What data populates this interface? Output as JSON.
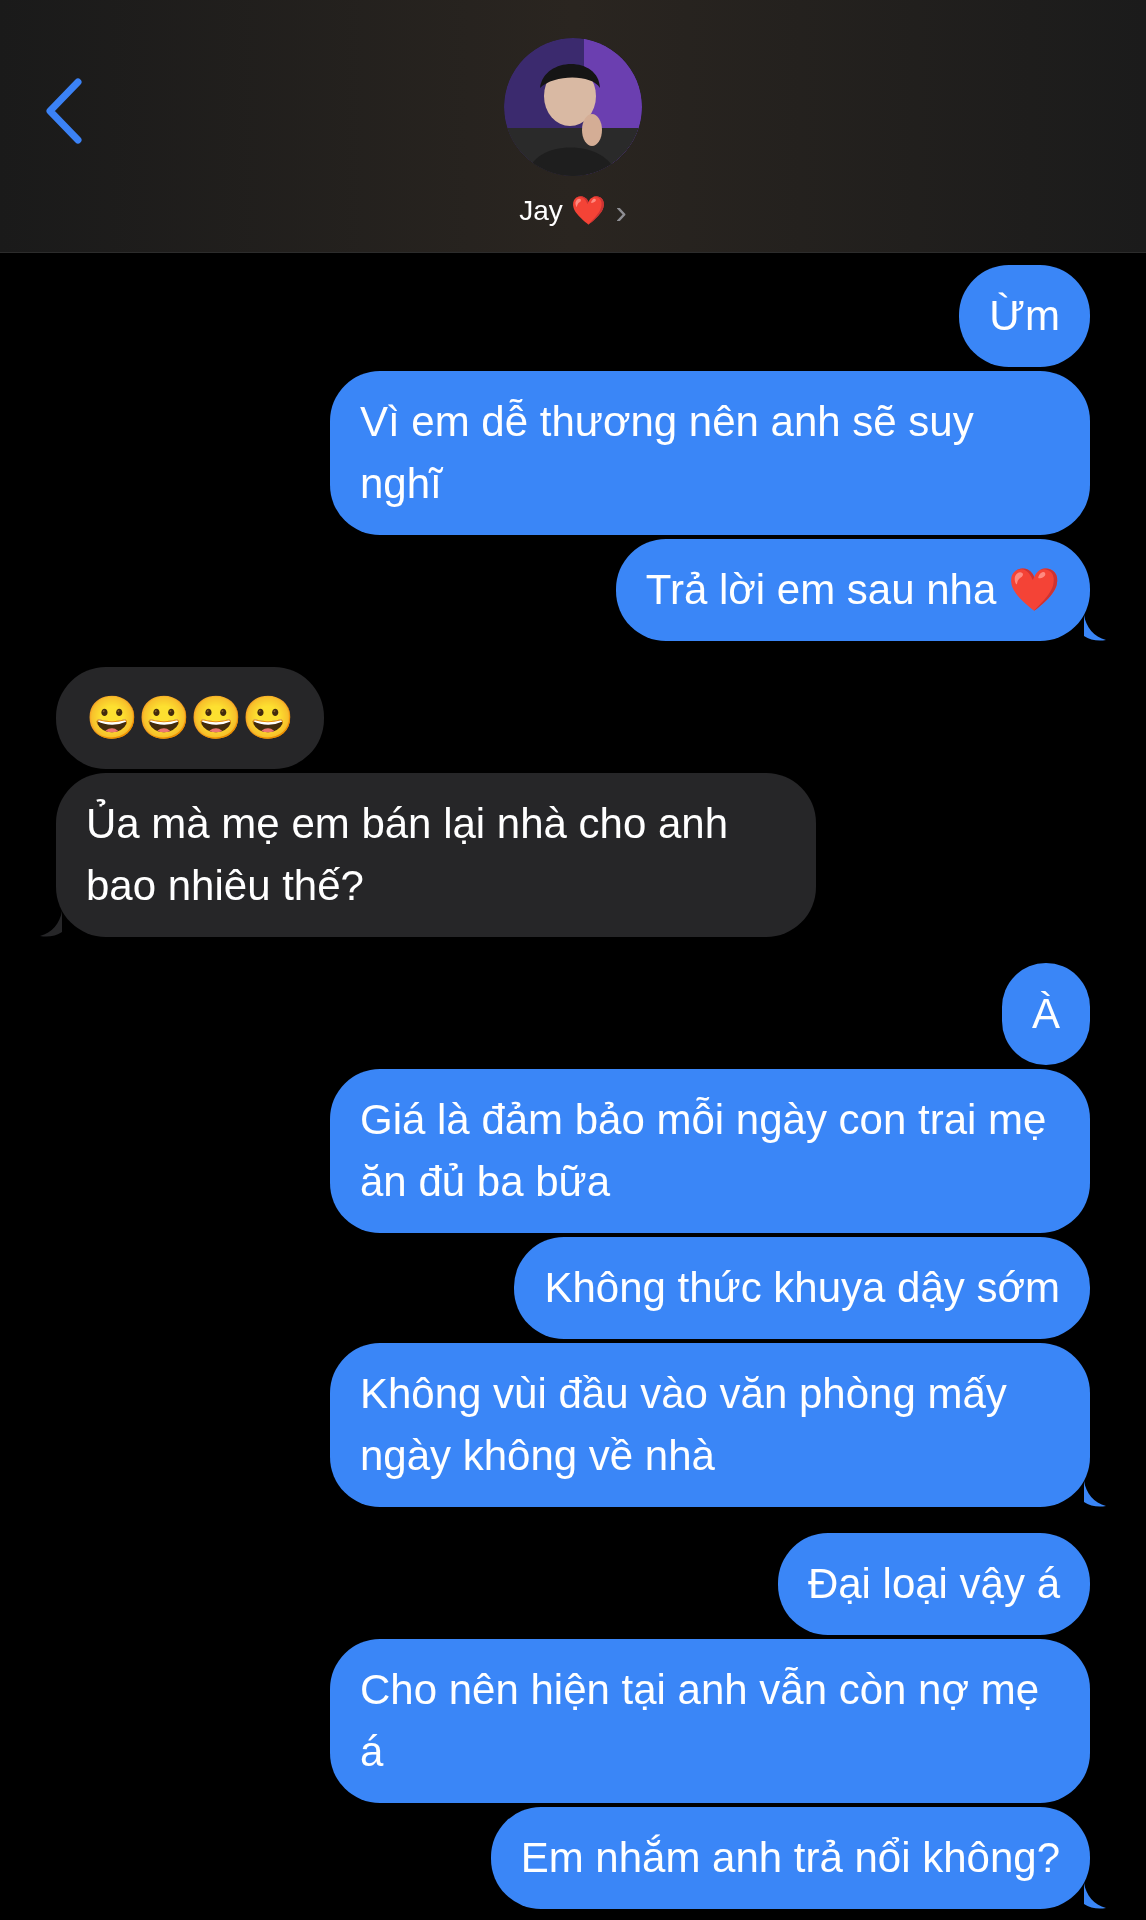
{
  "header": {
    "contact_name": "Jay ❤️",
    "chevron": "›"
  },
  "messages": [
    {
      "kind": "sent",
      "text": "Ừm",
      "tail": false
    },
    {
      "kind": "sent",
      "text": "Vì em dễ thương nên anh sẽ suy nghĩ",
      "tail": false
    },
    {
      "kind": "sent",
      "text": "Trả lời em sau nha ❤️",
      "tail": true
    },
    {
      "kind": "received",
      "text": "😀😀😀😀",
      "tail": false
    },
    {
      "kind": "received",
      "text": "Ủa mà mẹ em bán lại nhà cho anh bao nhiêu thế?",
      "tail": true
    },
    {
      "kind": "sent",
      "text": "À",
      "tail": false
    },
    {
      "kind": "sent",
      "text": "Giá là đảm bảo mỗi ngày con trai mẹ ăn đủ ba bữa",
      "tail": false
    },
    {
      "kind": "sent",
      "text": "Không thức khuya dậy sớm",
      "tail": false
    },
    {
      "kind": "sent",
      "text": "Không vùi đầu vào văn phòng mấy ngày không về nhà",
      "tail": true
    },
    {
      "kind": "sent",
      "text": "Đại loại vậy á",
      "tail": false
    },
    {
      "kind": "sent",
      "text": "Cho nên hiện tại anh vẫn còn nợ mẹ á",
      "tail": false
    },
    {
      "kind": "sent",
      "text": "Em nhắm anh trả nổi không?",
      "tail": true
    }
  ]
}
